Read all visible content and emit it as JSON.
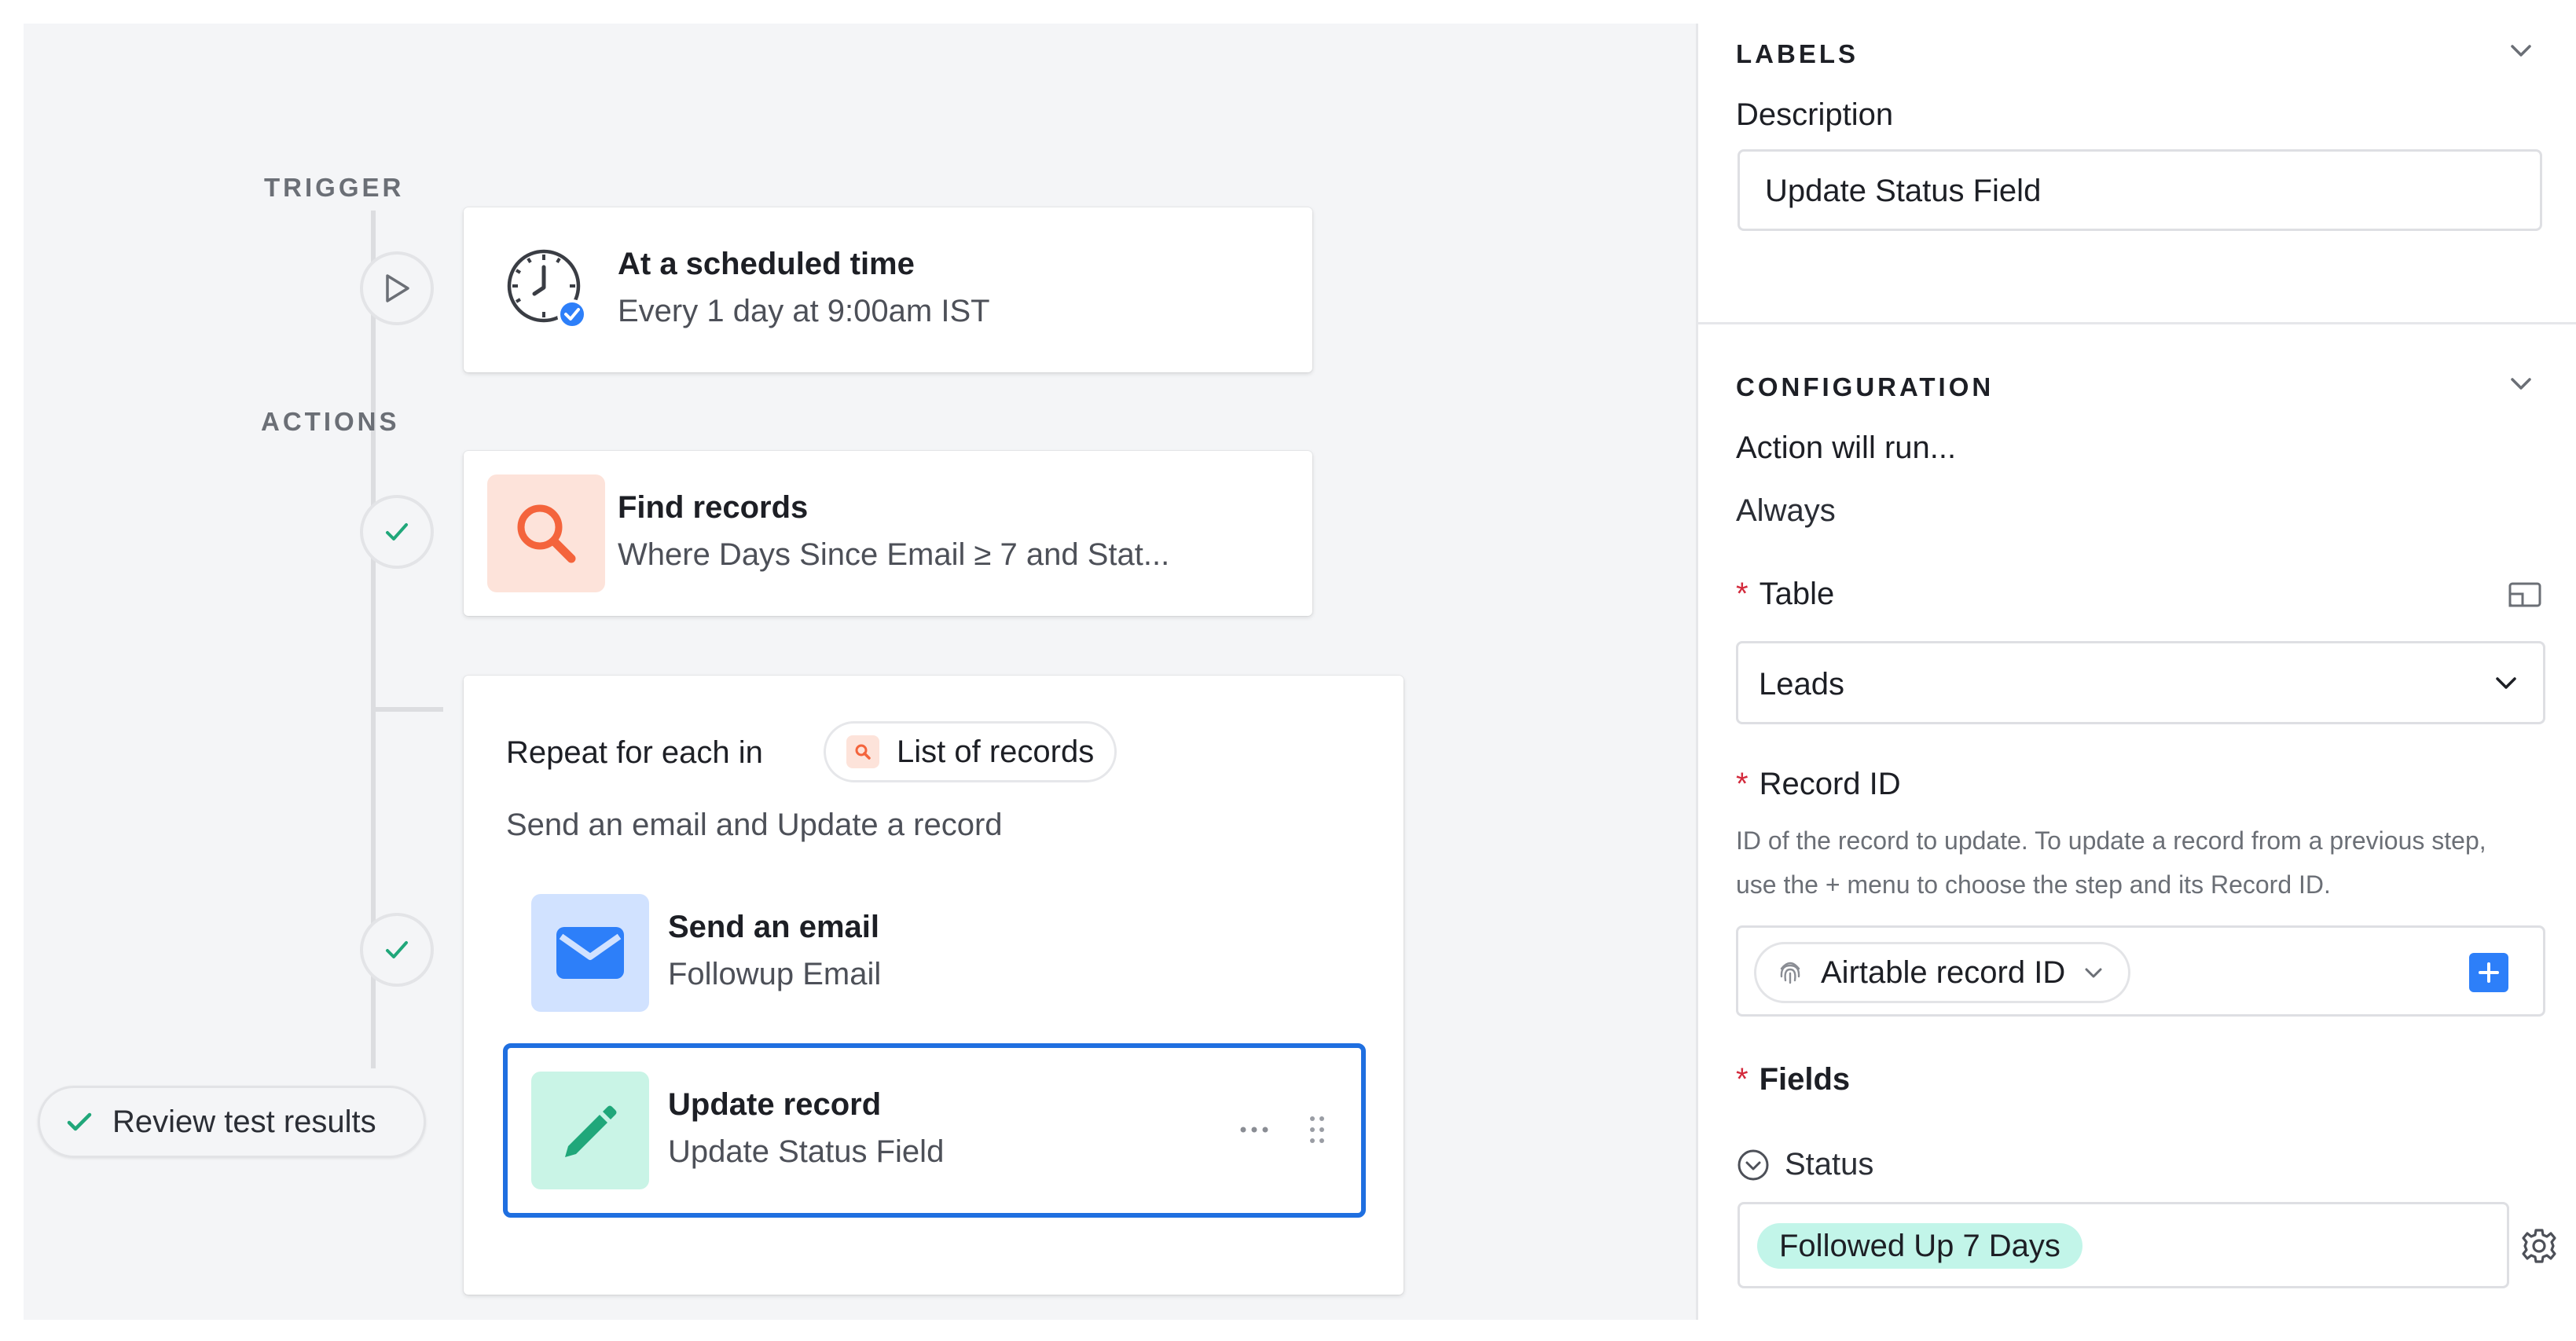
{
  "workflow": {
    "trigger_label": "TRIGGER",
    "actions_label": "ACTIONS",
    "trigger_card": {
      "title": "At a scheduled time",
      "subtitle": "Every 1 day at 9:00am IST",
      "icon": "clock-check-icon"
    },
    "find_card": {
      "title": "Find records",
      "subtitle": "Where Days Since Email ≥ 7 and Stat...",
      "icon": "search-icon"
    },
    "repeat_card": {
      "prefix": "Repeat for each in",
      "chip_label": "List of records",
      "description": "Send an email and Update a record",
      "steps": [
        {
          "title": "Send an email",
          "subtitle": "Followup Email",
          "icon": "envelope-icon"
        },
        {
          "title": "Update record",
          "subtitle": "Update Status Field",
          "icon": "pencil-icon",
          "selected": true
        }
      ]
    },
    "review_button": "Review test results"
  },
  "panel": {
    "labels_heading": "LABELS",
    "description_label": "Description",
    "description_value": "Update Status Field",
    "configuration_heading": "CONFIGURATION",
    "action_runs_label": "Action will run...",
    "action_runs_value": "Always",
    "required_mark": "*",
    "table_label": "Table",
    "table_value": "Leads",
    "record_id_label": "Record ID",
    "record_id_help": "ID of the record to update. To update a record from a previous step, use the + menu to choose the step and its Record ID.",
    "record_id_token": "Airtable record ID",
    "fields_label": "Fields",
    "status_label": "Status",
    "status_value": "Followed Up 7 Days"
  },
  "colors": {
    "accent_blue": "#2d7ff9",
    "search_tile": "#fde3da",
    "search_icon": "#f4643c",
    "email_tile": "#d1e2ff",
    "email_icon": "#2d7ff9",
    "update_tile": "#c9f4e6",
    "update_icon": "#20a77a",
    "status_pill": "#c2f5e9"
  }
}
